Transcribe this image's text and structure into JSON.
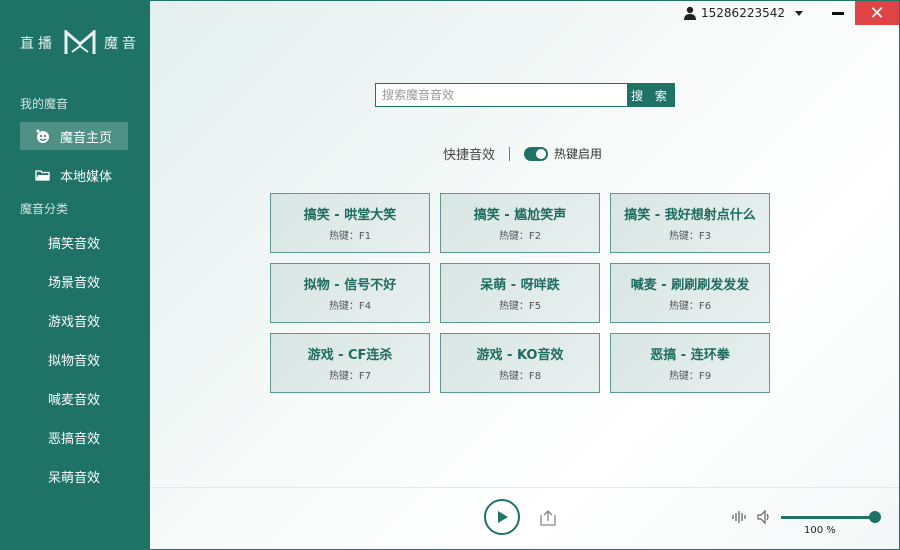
{
  "app": {
    "logo_text_left": "直播",
    "logo_text_right": "魔音"
  },
  "sidebar": {
    "my_section": "我的魔音",
    "nav": [
      {
        "label": "魔音主页",
        "icon": "smiley-icon",
        "active": true
      },
      {
        "label": "本地媒体",
        "icon": "folder-icon",
        "active": false
      }
    ],
    "category_section": "魔音分类",
    "categories": [
      "搞笑音效",
      "场景音效",
      "游戏音效",
      "拟物音效",
      "喊麦音效",
      "恶搞音效",
      "呆萌音效"
    ]
  },
  "topbar": {
    "user_id": "15286223542",
    "close_symbol": "✕"
  },
  "search": {
    "placeholder": "搜索魔音音效",
    "button_label": "搜 索"
  },
  "quick": {
    "label": "快捷音效",
    "toggle_label": "热键启用",
    "toggle_on": true
  },
  "effects": [
    {
      "title": "搞笑 - 哄堂大笑",
      "hotkey": "热键：F1"
    },
    {
      "title": "搞笑 - 尴尬笑声",
      "hotkey": "热键：F2"
    },
    {
      "title": "搞笑 - 我好想射点什么",
      "hotkey": "热键：F3"
    },
    {
      "title": "拟物 - 信号不好",
      "hotkey": "热键：F4"
    },
    {
      "title": "呆萌 - 呀咩跌",
      "hotkey": "热键：F5"
    },
    {
      "title": "喊麦 - 刷刷刷发发发",
      "hotkey": "热键：F6"
    },
    {
      "title": "游戏 - CF连杀",
      "hotkey": "热键：F7"
    },
    {
      "title": "游戏 - KO音效",
      "hotkey": "热键：F8"
    },
    {
      "title": "恶搞 - 连环拳",
      "hotkey": "热键：F9"
    }
  ],
  "player": {
    "volume_label": "100 %",
    "volume_fraction": 1.0
  },
  "colors": {
    "brand": "#1e7266",
    "close": "#e04343"
  }
}
